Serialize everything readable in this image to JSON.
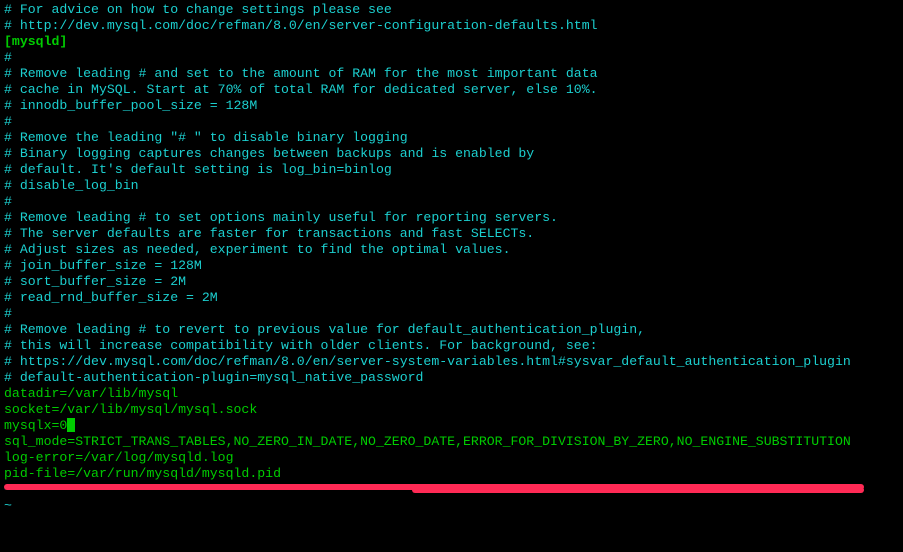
{
  "lines": [
    {
      "cls": "comment",
      "text": "# For advice on how to change settings please see"
    },
    {
      "cls": "comment",
      "text": "# http://dev.mysql.com/doc/refman/8.0/en/server-configuration-defaults.html"
    },
    {
      "cls": "comment",
      "text": ""
    },
    {
      "cls": "section",
      "text": "[mysqld]"
    },
    {
      "cls": "comment",
      "text": "#"
    },
    {
      "cls": "comment",
      "text": "# Remove leading # and set to the amount of RAM for the most important data"
    },
    {
      "cls": "comment",
      "text": "# cache in MySQL. Start at 70% of total RAM for dedicated server, else 10%."
    },
    {
      "cls": "comment",
      "text": "# innodb_buffer_pool_size = 128M"
    },
    {
      "cls": "comment",
      "text": "#"
    },
    {
      "cls": "comment",
      "text": "# Remove the leading \"# \" to disable binary logging"
    },
    {
      "cls": "comment",
      "text": "# Binary logging captures changes between backups and is enabled by"
    },
    {
      "cls": "comment",
      "text": "# default. It's default setting is log_bin=binlog"
    },
    {
      "cls": "comment",
      "text": "# disable_log_bin"
    },
    {
      "cls": "comment",
      "text": "#"
    },
    {
      "cls": "comment",
      "text": "# Remove leading # to set options mainly useful for reporting servers."
    },
    {
      "cls": "comment",
      "text": "# The server defaults are faster for transactions and fast SELECTs."
    },
    {
      "cls": "comment",
      "text": "# Adjust sizes as needed, experiment to find the optimal values."
    },
    {
      "cls": "comment",
      "text": "# join_buffer_size = 128M"
    },
    {
      "cls": "comment",
      "text": "# sort_buffer_size = 2M"
    },
    {
      "cls": "comment",
      "text": "# read_rnd_buffer_size = 2M"
    },
    {
      "cls": "comment",
      "text": "#"
    },
    {
      "cls": "comment",
      "text": "# Remove leading # to revert to previous value for default_authentication_plugin,"
    },
    {
      "cls": "comment",
      "text": "# this will increase compatibility with older clients. For background, see:"
    },
    {
      "cls": "comment",
      "text": "# https://dev.mysql.com/doc/refman/8.0/en/server-system-variables.html#sysvar_default_authentication_plugin"
    },
    {
      "cls": "comment",
      "text": "# default-authentication-plugin=mysql_native_password"
    },
    {
      "cls": "comment",
      "text": ""
    },
    {
      "cls": "code",
      "text": "datadir=/var/lib/mysql"
    },
    {
      "cls": "code",
      "text": "socket=/var/lib/mysql/mysql.sock"
    },
    {
      "cls": "code",
      "text": "mysqlx=0",
      "cursor": true
    },
    {
      "cls": "code",
      "text": "sql_mode=STRICT_TRANS_TABLES,NO_ZERO_IN_DATE,NO_ZERO_DATE,ERROR_FOR_DIVISION_BY_ZERO,NO_ENGINE_SUBSTITUTION"
    },
    {
      "cls": "comment",
      "text": ""
    },
    {
      "cls": "code",
      "text": "log-error=/var/log/mysqld.log"
    },
    {
      "cls": "code",
      "text": "pid-file=/var/run/mysqld/mysqld.pid"
    },
    {
      "cls": "tilde",
      "text": "~"
    },
    {
      "cls": "tilde",
      "text": "~"
    }
  ],
  "annotation": {
    "type": "underline",
    "color": "#ff2a55",
    "target_line_index": 29
  }
}
